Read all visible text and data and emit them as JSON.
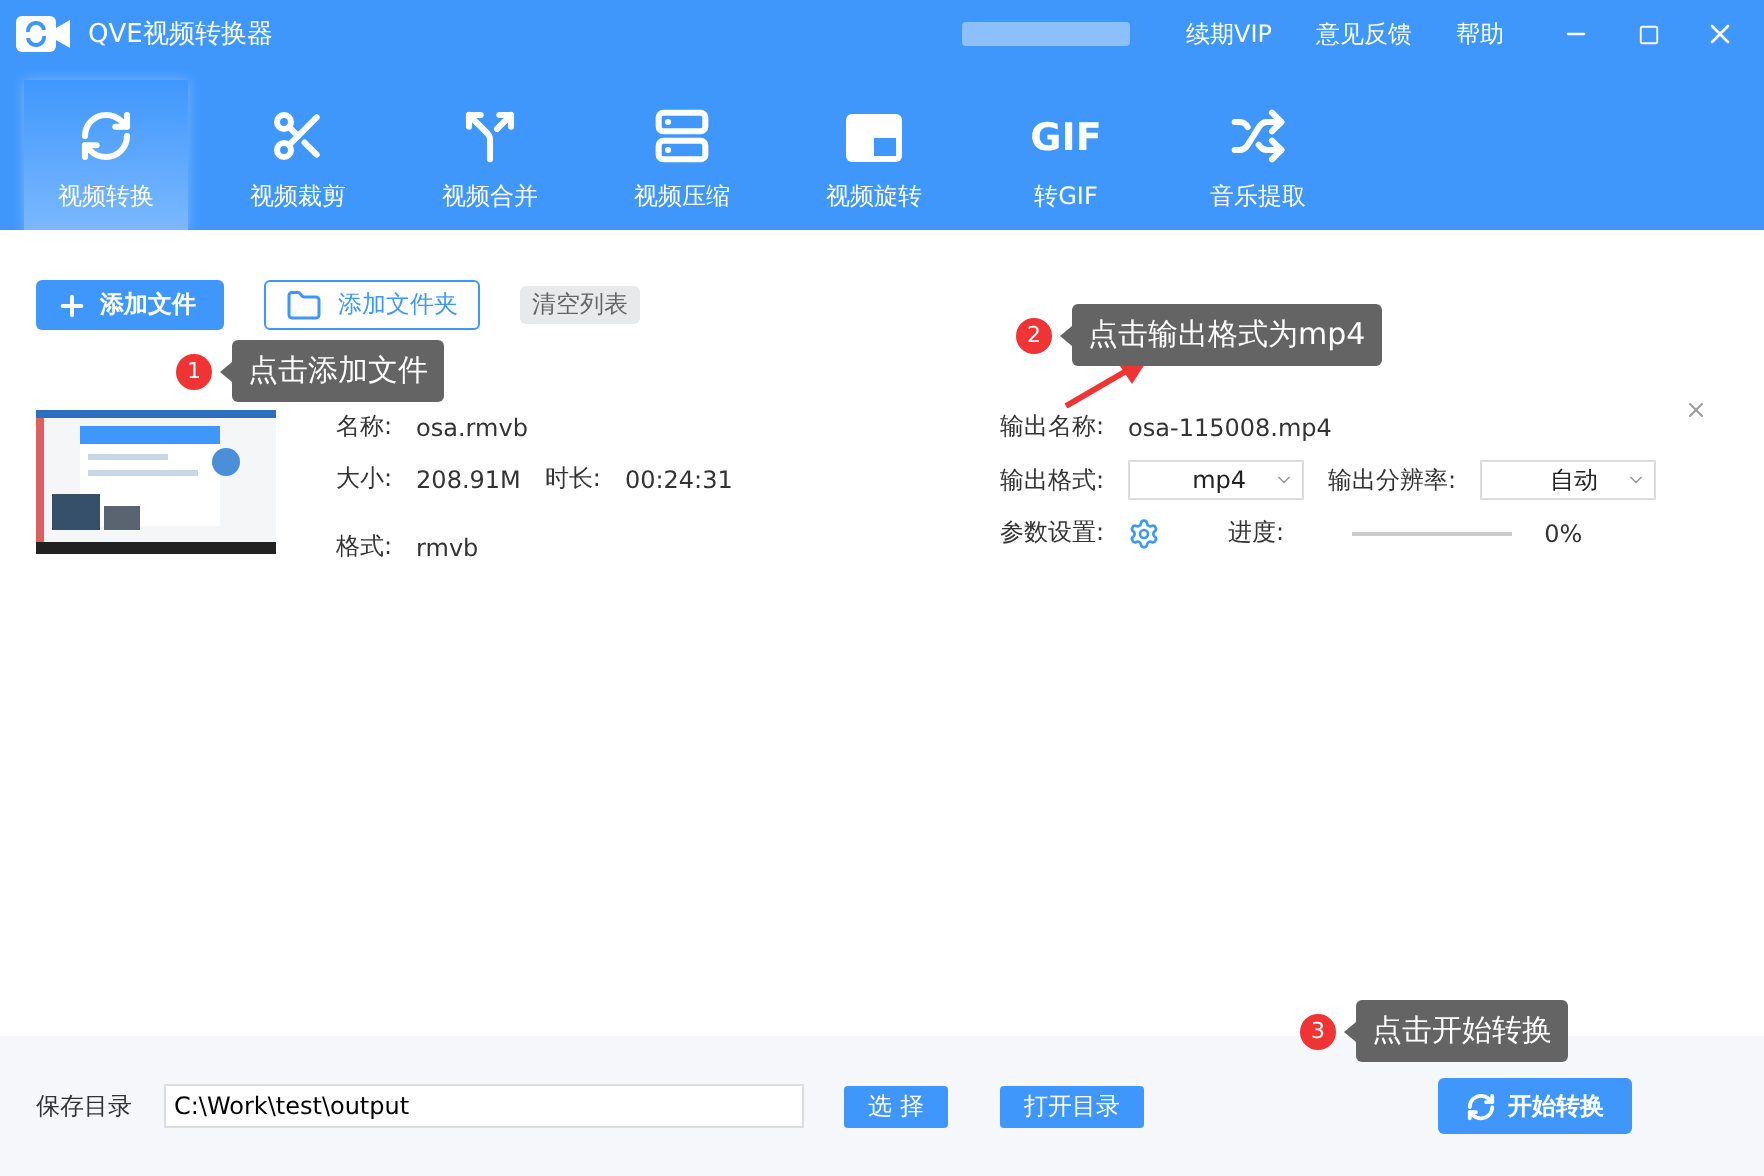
{
  "window": {
    "title": "QVE视频转换器"
  },
  "header_links": [
    "续期VIP",
    "意见反馈",
    "帮助"
  ],
  "tabs": [
    {
      "label": "视频转换",
      "selected": true
    },
    {
      "label": "视频裁剪",
      "selected": false
    },
    {
      "label": "视频合并",
      "selected": false
    },
    {
      "label": "视频压缩",
      "selected": false
    },
    {
      "label": "视频旋转",
      "selected": false
    },
    {
      "label": "转GIF",
      "selected": false,
      "icon_text": "GIF"
    },
    {
      "label": "音乐提取",
      "selected": false
    }
  ],
  "toolbar": {
    "add_file": "添加文件",
    "add_folder": "添加文件夹",
    "clear": "清空列表"
  },
  "file": {
    "name_label": "名称:",
    "name": "osa.rmvb",
    "size_label": "大小:",
    "size": "208.91M",
    "duration_label": "时长:",
    "duration": "00:24:31",
    "format_label": "格式:",
    "format": "rmvb",
    "output_name_label": "输出名称:",
    "output_name": "osa-115008.mp4",
    "output_format_label": "输出格式:",
    "output_format": "mp4",
    "resolution_label": "输出分辨率:",
    "resolution": "自动",
    "params_label": "参数设置:",
    "progress_label": "进度:",
    "level": 0,
    "progress": "0%"
  },
  "callouts": [
    {
      "number": "1",
      "text": "点击添加文件"
    },
    {
      "number": "2",
      "text": "点击输出格式为mp4"
    },
    {
      "number": "3",
      "text": "点击开始转换"
    }
  ],
  "footer": {
    "save_label": "保存目录",
    "path": "C:\\Work\\test\\output",
    "choose": "选 择",
    "open": "打开目录",
    "start": "开始转换"
  }
}
